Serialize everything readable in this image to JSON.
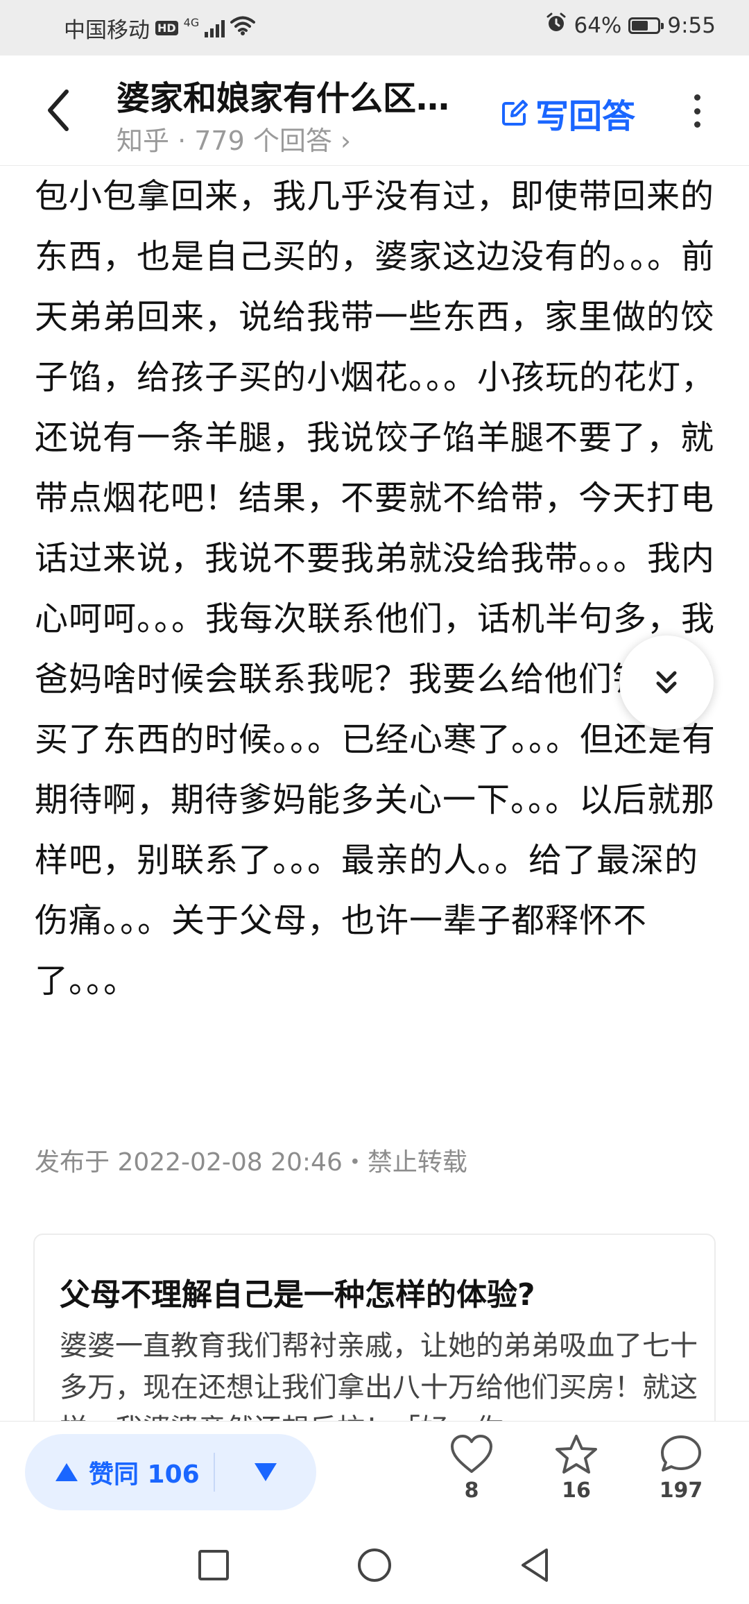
{
  "status_bar": {
    "carrier": "中国移动",
    "hd_badge": "HD",
    "network": "4G",
    "battery": "64%",
    "battery_level": 0.64,
    "time": "9:55"
  },
  "header": {
    "title": "婆家和娘家有什么区…",
    "subtitle": "知乎 · 779 个回答 ›",
    "write_answer_label": "写回答",
    "back_icon": "chevron-left-icon",
    "write_icon": "edit-icon",
    "more_icon": "more-vertical-icon",
    "accent_color": "#1a66ff"
  },
  "article": {
    "body": "包小包拿回来，我几乎没有过，即使带回来的东西，也是自己买的，婆家这边没有的。。。前天弟弟回来，说给我带一些东西，家里做的饺子馅，给孩子买的小烟花。。。小孩玩的花灯，还说有一条羊腿，我说饺子馅羊腿不要了，就带点烟花吧！结果，不要就不给带，今天打电话过来说，我说不要我弟就没给我带。。。我内心呵呵。。。我每次联系他们，话机半句多，我爸妈啥时候会联系我呢？我要么给他们钱或者买了东西的时候。。。已经心寒了。。。但还是有期待啊，期待爹妈能多关心一下。。。以后就那样吧，别联系了。。。最亲的人。。给了最深的伤痛。。。关于父母，也许一辈子都释怀不了。。。",
    "meta": "发布于 2022-02-08 20:46・禁止转载",
    "scroll_icon": "double-chevron-down-icon"
  },
  "related_card": {
    "title": "父母不理解自己是一种怎样的体验?",
    "excerpt": "婆婆一直教育我们帮衬亲戚，让她的弟弟吸血了七十多万，现在还想让我们拿出八十万给他们买房！就这样，我婆婆竟然还想反抗！「好，你"
  },
  "action_bar": {
    "upvote_label": "赞同 106",
    "upvote_icon": "triangle-up-icon",
    "downvote_icon": "triangle-down-icon",
    "like_count": "8",
    "like_icon": "heart-icon",
    "favorite_count": "16",
    "favorite_icon": "star-icon",
    "comment_count": "197",
    "comment_icon": "comment-icon"
  },
  "nav_bar": {
    "recents_icon": "square-icon",
    "home_icon": "circle-icon",
    "back_icon": "triangle-back-icon"
  }
}
